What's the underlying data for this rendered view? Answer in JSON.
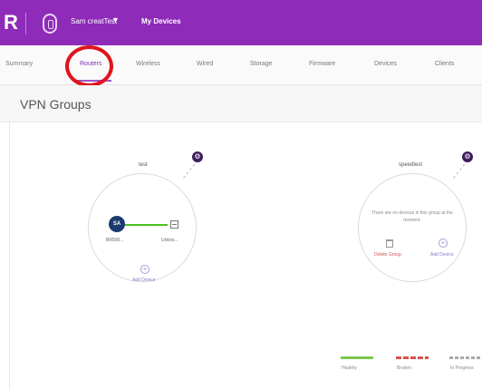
{
  "topbar": {
    "logo": "R",
    "org_name": "Sam creatTest",
    "org_chevron": "▾",
    "my_devices": "My Devices",
    "color": "#8e2bb8"
  },
  "tabs": [
    {
      "label": "Summary",
      "active": false
    },
    {
      "label": "Routers",
      "active": true
    },
    {
      "label": "Wireless",
      "active": false
    },
    {
      "label": "Wired",
      "active": false
    },
    {
      "label": "Storage",
      "active": false
    },
    {
      "label": "Firmware",
      "active": false
    },
    {
      "label": "Devices",
      "active": false
    },
    {
      "label": "Clients",
      "active": false
    }
  ],
  "page": {
    "title": "VPN Groups"
  },
  "groups": [
    {
      "name": "test",
      "settings_icon": "gear-icon",
      "devices": [
        {
          "badge": "SA",
          "label": "BR500..."
        },
        {
          "label": "Unkno..."
        }
      ],
      "add_label": "Add Device"
    },
    {
      "name": "speedtest",
      "settings_icon": "gear-icon",
      "empty_message": "There are no devices in this group at the moment.",
      "delete_label": "Delete Group",
      "add_label": "Add Device"
    }
  ],
  "legend": [
    {
      "label": "Healthy",
      "color": "#7cc750",
      "style": "solid"
    },
    {
      "label": "Broken",
      "color": "#d9534f",
      "style": "dashed"
    },
    {
      "label": "In Progress",
      "color": "#aaaaaa",
      "style": "dashed"
    }
  ]
}
